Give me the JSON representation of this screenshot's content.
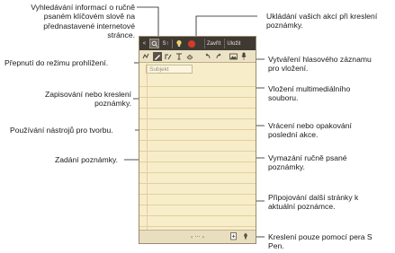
{
  "annotations": {
    "search_info": "Vyhledávání informací o ručně\npsaném klíčovém slově na\npřednastavené internetové\nstránce.",
    "save_actions": "Ukládání vašich akcí při kreslení\npoznámky.",
    "view_mode": "Přepnutí do režimu prohlížení.",
    "voice_memo": "Vytváření hlasového záznamu\npro vložení.",
    "write_draw": "Zapisování nebo kreslení\npoznámky.",
    "insert_media": "Vložení multimediálního\nsouboru.",
    "creation_tools": "Používání nástrojů pro tvorbu.",
    "undo_redo": "Vrácení nebo opakování\nposlední akce.",
    "enter_note": "Zadání poznámky.",
    "erase": "Vymazání ručně psané\npoznámky.",
    "add_page": "Připojování další stránky k\naktuální poznámce.",
    "spen_only": "Kreslení pouze pomocí pera S\nPen."
  },
  "topbar": {
    "back": "<",
    "s_label": "S↑",
    "close": "Zavřít",
    "save": "Uložit"
  },
  "editor": {
    "subject_placeholder": "Subjekt",
    "page_indicator": "‹ ··· ›"
  },
  "icons": {
    "back": "chevron-left-icon",
    "search": "search-icon",
    "idea": "lightbulb-icon",
    "record": "record-icon",
    "view": "view-mode-icon",
    "pen": "pen-icon",
    "tools": "creation-tools-icon",
    "text": "text-icon",
    "eraser": "eraser-icon",
    "undo": "undo-icon",
    "redo": "redo-icon",
    "media": "image-icon",
    "mic": "microphone-icon",
    "add_page": "add-page-icon",
    "spen": "spen-icon"
  },
  "colors": {
    "topbar": "#3e3a33",
    "paper": "#f7edc9",
    "record": "#d63b2a"
  }
}
